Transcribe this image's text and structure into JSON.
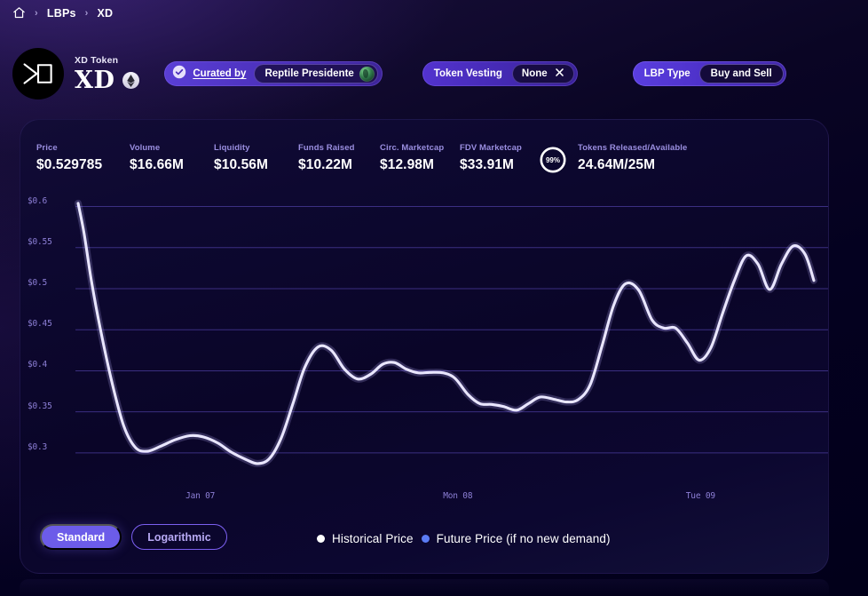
{
  "breadcrumb": {
    "home_icon": "home-icon",
    "separator": "›",
    "items": [
      "LBPs",
      "XD"
    ]
  },
  "header": {
    "logo_icon": "xd-token-logo",
    "token_subtitle": "XD Token",
    "token_symbol": "XD",
    "chain_icon": "ethereum-icon",
    "curated": {
      "verified_icon": "verified-check-icon",
      "label": "Curated by",
      "curator": "Reptile Presidente",
      "avatar_icon": "curator-avatar"
    },
    "vesting": {
      "label": "Token Vesting",
      "value": "None",
      "clear_icon": "close-icon"
    },
    "lbp_type": {
      "label": "LBP Type",
      "value": "Buy and Sell"
    }
  },
  "stats": [
    {
      "label": "Price",
      "value": "$0.529785"
    },
    {
      "label": "Volume",
      "value": "$16.66M"
    },
    {
      "label": "Liquidity",
      "value": "$10.56M"
    },
    {
      "label": "Funds Raised",
      "value": "$10.22M"
    },
    {
      "label": "Circ. Marketcap",
      "value": "$12.98M"
    },
    {
      "label": "FDV Marketcap",
      "value": "$33.91M"
    }
  ],
  "released": {
    "percent": "99%",
    "percent_value": 99,
    "label": "Tokens Released/Available",
    "value": "24.64M/25M"
  },
  "controls": {
    "scale_standard": "Standard",
    "scale_logarithmic": "Logarithmic",
    "active_scale": "Standard"
  },
  "legend": [
    {
      "label": "Historical Price",
      "color": "#ffffff"
    },
    {
      "label": "Future Price (if no new demand)",
      "color": "#5b7cf5"
    }
  ],
  "colors": {
    "accent": "#6c5ce9",
    "accent_outline": "#7b5ff0",
    "axis_text": "#8d7fd6",
    "gridline": "#4b3c9e",
    "line": "#e9e6ff",
    "panel_bg": "#0c0730",
    "page_bg": "#03001a"
  },
  "chart_data": {
    "type": "line",
    "title": "",
    "xlabel": "",
    "ylabel": "",
    "ylim": [
      0.275,
      0.6125
    ],
    "grid": true,
    "legend_position": "bottom",
    "y_ticks": [
      "$0.6",
      "$0.55",
      "$0.5",
      "$0.45",
      "$0.4",
      "$0.35",
      "$0.3"
    ],
    "y_tick_values": [
      0.6,
      0.55,
      0.5,
      0.45,
      0.4,
      0.35,
      0.3
    ],
    "x_ticks": [
      "Jan 07",
      "Mon 08",
      "Tue 09"
    ],
    "x_tick_fractions": [
      0.175,
      0.525,
      0.855
    ],
    "series": [
      {
        "name": "Historical Price",
        "color": "#e9e6ff",
        "x": [
          0.0,
          0.008,
          0.018,
          0.03,
          0.046,
          0.062,
          0.078,
          0.094,
          0.112,
          0.132,
          0.152,
          0.17,
          0.19,
          0.208,
          0.228,
          0.244,
          0.26,
          0.276,
          0.292,
          0.308,
          0.326,
          0.344,
          0.362,
          0.38,
          0.398,
          0.414,
          0.43,
          0.446,
          0.462,
          0.478,
          0.496,
          0.512,
          0.53,
          0.546,
          0.562,
          0.578,
          0.596,
          0.612,
          0.628,
          0.646,
          0.664,
          0.68,
          0.696,
          0.712,
          0.728,
          0.744,
          0.762,
          0.78,
          0.796,
          0.812,
          0.828,
          0.844,
          0.86,
          0.876,
          0.892,
          0.908,
          0.924,
          0.94,
          0.956,
          0.972,
          0.988,
          1.0
        ],
        "y": [
          0.604,
          0.568,
          0.51,
          0.452,
          0.386,
          0.333,
          0.3065,
          0.302,
          0.308,
          0.316,
          0.321,
          0.3195,
          0.312,
          0.301,
          0.292,
          0.287,
          0.293,
          0.318,
          0.36,
          0.404,
          0.429,
          0.425,
          0.402,
          0.39,
          0.396,
          0.408,
          0.41,
          0.402,
          0.3975,
          0.398,
          0.3975,
          0.391,
          0.371,
          0.36,
          0.359,
          0.3565,
          0.352,
          0.36,
          0.368,
          0.3655,
          0.362,
          0.365,
          0.383,
          0.43,
          0.48,
          0.506,
          0.498,
          0.462,
          0.452,
          0.452,
          0.434,
          0.413,
          0.428,
          0.47,
          0.51,
          0.54,
          0.53,
          0.499,
          0.53,
          0.552,
          0.542,
          0.51
        ]
      }
    ]
  }
}
